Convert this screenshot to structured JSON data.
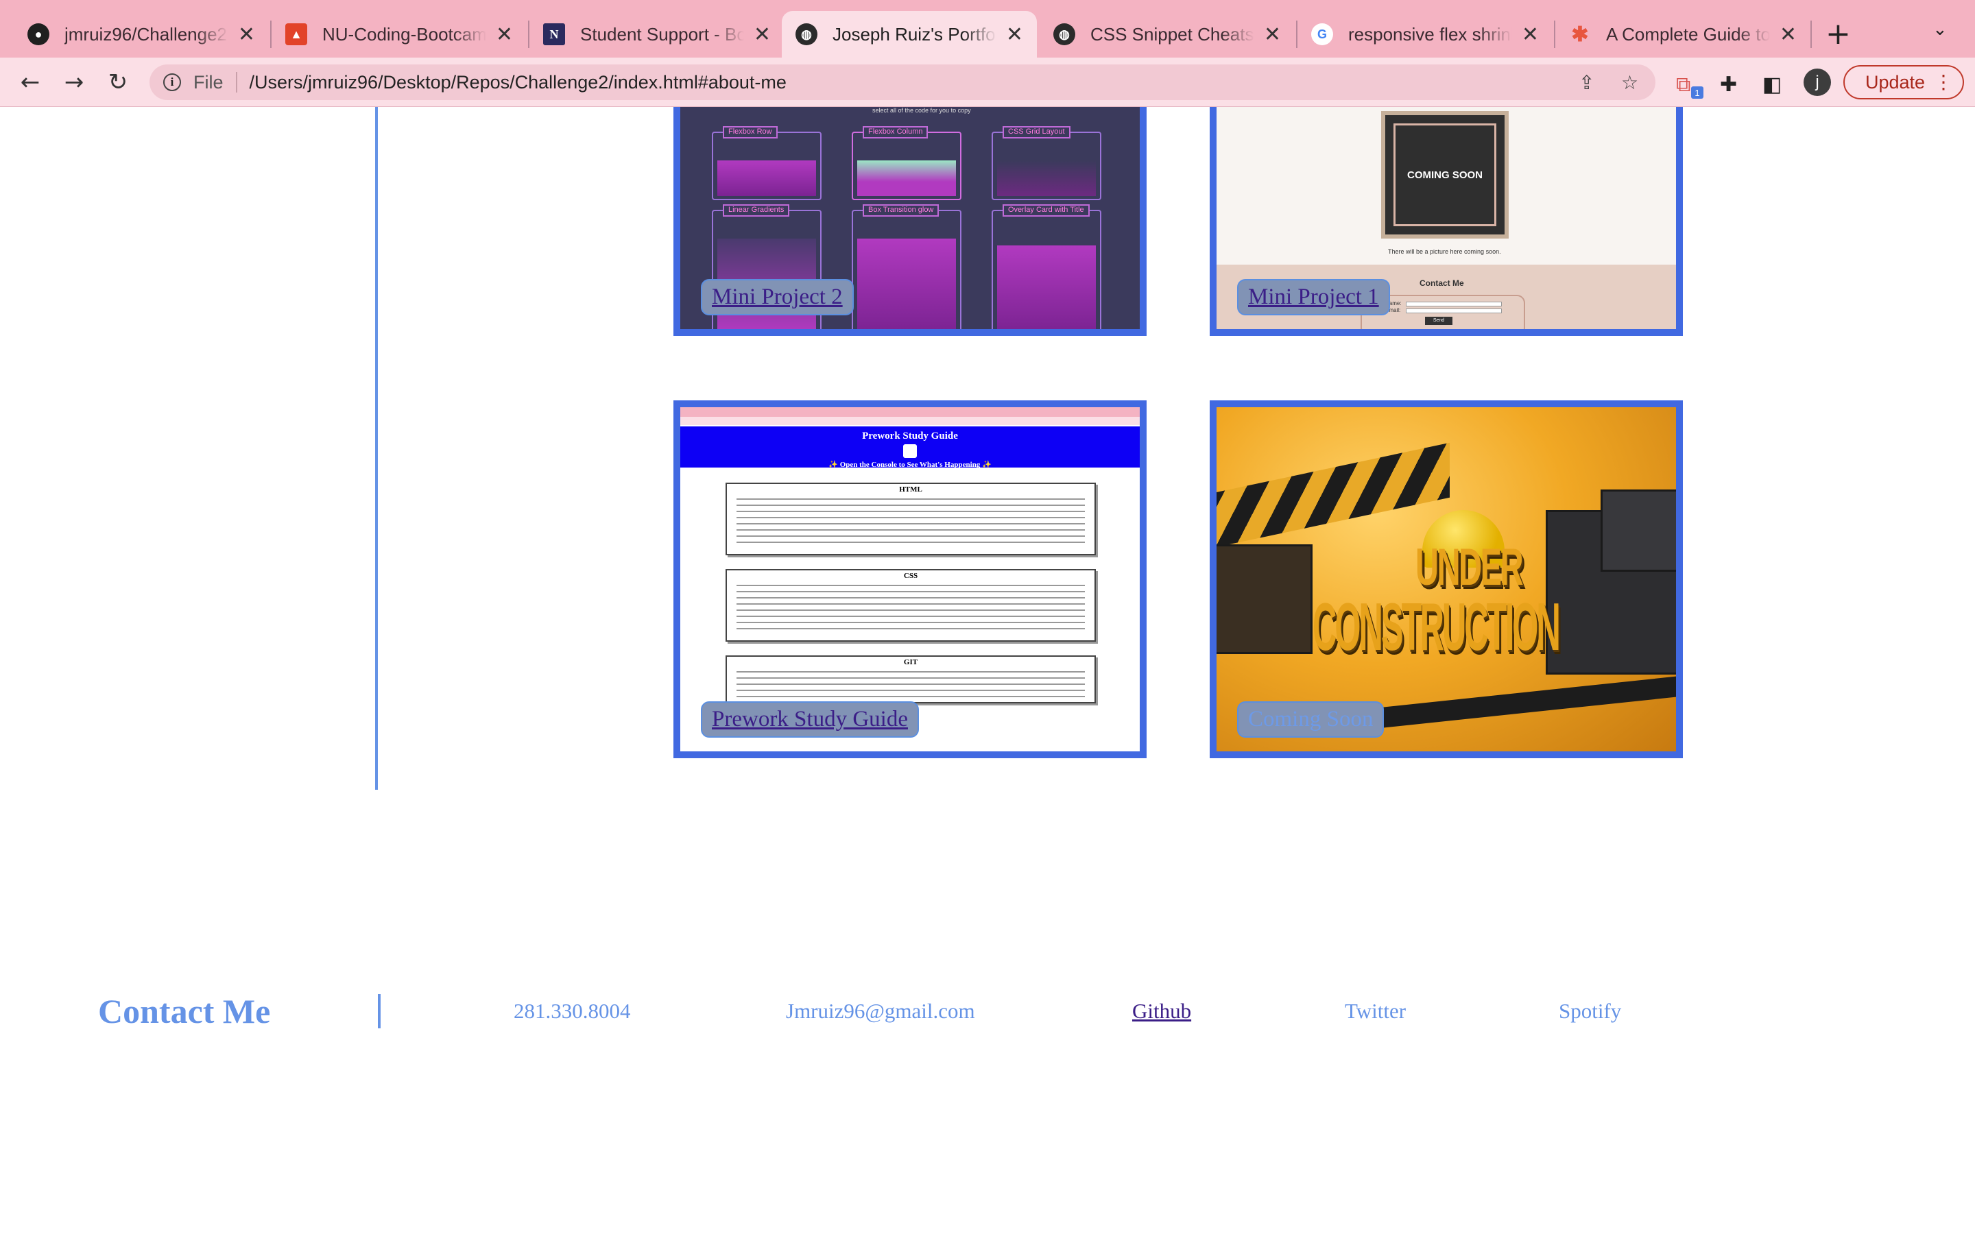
{
  "browser": {
    "tabs": [
      {
        "title": "jmruiz96/Challenge2: ",
        "favicon": "github-icon",
        "active": false
      },
      {
        "title": "NU-Coding-Bootcamp",
        "favicon": "gitlab-icon",
        "active": false
      },
      {
        "title": "Student Support - Bo",
        "favicon": "northwestern-icon",
        "active": false
      },
      {
        "title": "Joseph Ruiz's Portfoli",
        "favicon": "globe-icon",
        "active": true
      },
      {
        "title": "CSS Snippet Cheatsh",
        "favicon": "globe-icon",
        "active": false
      },
      {
        "title": "responsive flex shrink",
        "favicon": "google-icon",
        "active": false
      },
      {
        "title": "A Complete Guide to F",
        "favicon": "css-tricks-icon",
        "active": false
      }
    ],
    "favicon_letter_n": "N",
    "favicon_letter_g": "G",
    "address": {
      "scheme": "File",
      "url": "/Users/jmruiz96/Desktop/Repos/Challenge2/index.html#about-me"
    },
    "extension_badge": "1",
    "profile_initial": "j",
    "update_label": "Update"
  },
  "projects": [
    {
      "label": "Mini Project 2",
      "link": true
    },
    {
      "label": "Mini Project 1",
      "link": true
    },
    {
      "label": "Prework Study Guide",
      "link": true
    },
    {
      "label": "Coming Soon",
      "link": false
    }
  ],
  "thumbnails": {
    "cheatsheet": {
      "caption": "select all of the code for you to copy",
      "snippets": [
        "Flexbox Row",
        "Flexbox Column",
        "CSS Grid Layout",
        "Linear Gradients",
        "Box Transition glow",
        "Overlay Card with Title"
      ]
    },
    "mini_project_1": {
      "coming_soon": "COMING SOON",
      "picture_note": "There will be a picture here coming soon.",
      "contact_heading": "Contact Me",
      "name_label": "Name:",
      "email_label": "Email:",
      "send_label": "Send"
    },
    "prework": {
      "title": "Prework Study Guide",
      "subtitle": "✨ Open the Console to See What's Happening ✨",
      "sections": [
        "HTML",
        "CSS",
        "GIT"
      ]
    },
    "under_construction": {
      "line1": "UNDER",
      "line2": "CONSTRUCTION"
    }
  },
  "footer": {
    "title": "Contact Me",
    "phone": "281.330.8004",
    "email": "Jmruiz96@gmail.com",
    "links": [
      {
        "label": "Github",
        "visited": true
      },
      {
        "label": "Twitter",
        "visited": false
      },
      {
        "label": "Spotify",
        "visited": false
      }
    ]
  },
  "colors": {
    "tab_strip": "#f4b3c2",
    "toolbar": "#fbdfe6",
    "accent_blue": "#6593e6",
    "card_border": "#4169e1",
    "visited_link": "#3b1e87",
    "update_red": "#c0392b"
  }
}
